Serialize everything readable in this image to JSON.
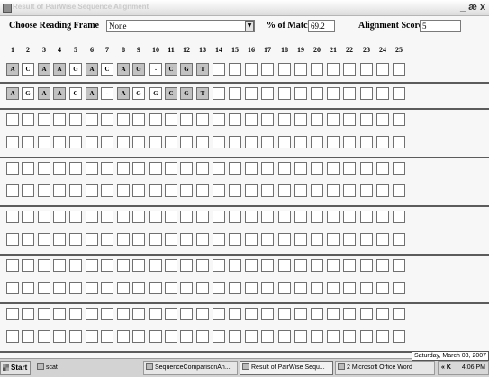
{
  "window": {
    "title": "Result of PairWise Sequence Alignment",
    "buttons": [
      "_",
      "æ",
      "x"
    ]
  },
  "toolbar": {
    "reading_frame_label": "Choose Reading Frame",
    "reading_frame_value": "None",
    "match_label": "% of Match",
    "match_value": "69.2",
    "score_label": "Alignment Score",
    "score_value": "5"
  },
  "columns": [
    "1",
    "2",
    "3",
    "4",
    "5",
    "6",
    "7",
    "8",
    "9",
    "10",
    "11",
    "12",
    "13",
    "14",
    "15",
    "16",
    "17",
    "18",
    "19",
    "20",
    "21",
    "22",
    "23",
    "24",
    "25"
  ],
  "sequence1": [
    "A",
    "C",
    "A",
    "A",
    "G",
    "A",
    "C",
    "A",
    "G",
    "-",
    "C",
    "G",
    "T"
  ],
  "sequence2": [
    "A",
    "G",
    "A",
    "A",
    "C",
    "A",
    "-",
    "A",
    "G",
    "G",
    "C",
    "G",
    "T"
  ],
  "seq1_shaded": [
    true,
    false,
    true,
    true,
    false,
    true,
    false,
    true,
    true,
    false,
    true,
    true,
    true
  ],
  "seq2_shaded": [
    true,
    false,
    true,
    true,
    false,
    true,
    false,
    true,
    false,
    false,
    true,
    true,
    true
  ],
  "taskbar": {
    "start_label": "Start",
    "items": [
      "scat",
      "SequenceComparisonAn...",
      "Result of PairWise Sequ...",
      "2 Microsoft Office Word"
    ],
    "tray_icons": "« K",
    "time": "4:06 PM",
    "date_tooltip": "Saturday, March 03, 2007"
  }
}
